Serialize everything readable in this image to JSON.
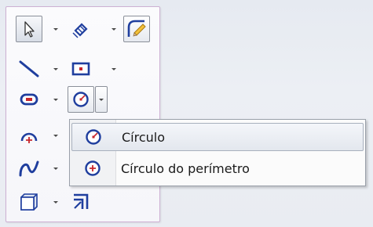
{
  "flyout": {
    "items": [
      {
        "label": "Círculo",
        "icon": "circle-icon"
      },
      {
        "label": "Círculo do perímetro",
        "icon": "perimeter-circle-icon"
      }
    ]
  },
  "colors": {
    "accent_blue": "#1f3e9e",
    "sketch_red": "#c8262c",
    "pencil_yellow": "#e0b030"
  }
}
